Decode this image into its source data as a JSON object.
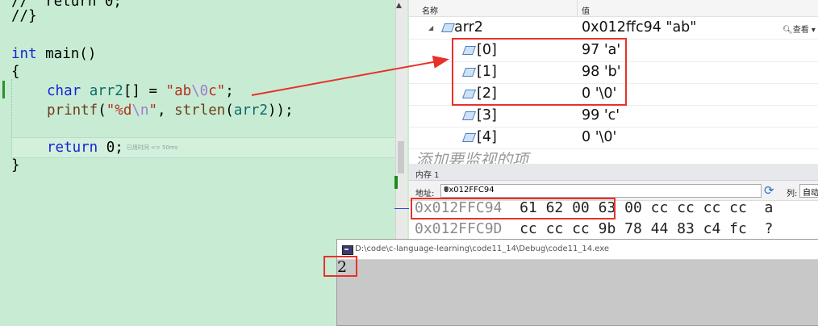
{
  "editor": {
    "lines": {
      "l0": "//  return 0;",
      "l1": "//}",
      "l3_kw": "int",
      "l3_rest": " main()",
      "l4": "{",
      "l5_kw": "char",
      "l5_var": " arr2",
      "l5_mid": "[] = ",
      "l5_str1": "\"ab",
      "l5_esc": "\\0",
      "l5_str2": "c\"",
      "l5_end": ";",
      "l6_fn": "printf",
      "l6_p1": "(",
      "l6_str1": "\"%d",
      "l6_esc": "\\n",
      "l6_str2": "\"",
      "l6_mid": ", ",
      "l6_fn2": "strlen",
      "l6_p2": "(",
      "l6_var": "arr2",
      "l6_end": "));",
      "l8_kw": "return",
      "l8_rest": " 0;",
      "l8_hint": "已用时间 <= 50ms",
      "l9": "}"
    }
  },
  "watch": {
    "headers": {
      "name": "名称",
      "value": "值"
    },
    "root": {
      "name": "arr2",
      "value": "0x012ffc94 \"ab\"",
      "view": "查看",
      "expand_glyph": "◢"
    },
    "items": [
      {
        "name": "[0]",
        "value": "97 'a'"
      },
      {
        "name": "[1]",
        "value": "98 'b'"
      },
      {
        "name": "[2]",
        "value": "0 '\\0'"
      },
      {
        "name": "[3]",
        "value": "99 'c'"
      },
      {
        "name": "[4]",
        "value": "0 '\\0'"
      }
    ],
    "add_placeholder": "添加要监视的项"
  },
  "memory": {
    "title": "内存 1",
    "address_label": "地址:",
    "address_value": "0x012FFC94",
    "columns_label": "列:",
    "columns_value": "自动",
    "rows": [
      {
        "addr": "0x012FFC94",
        "bytes_a": "61 62 00",
        "bytes_b": " 63 00 cc cc cc cc  a"
      },
      {
        "addr": "0x012FFC9D",
        "bytes_a": "cc cc cc",
        "bytes_b": " 9b 78 44 83 c4 fc  ?"
      }
    ]
  },
  "console": {
    "title": "D:\\code\\c-language-learning\\code11_14\\Debug\\code11_14.exe",
    "output": "2"
  },
  "colors": {
    "highlight_red": "#e8312a",
    "editor_bg": "#c8ecd3"
  }
}
